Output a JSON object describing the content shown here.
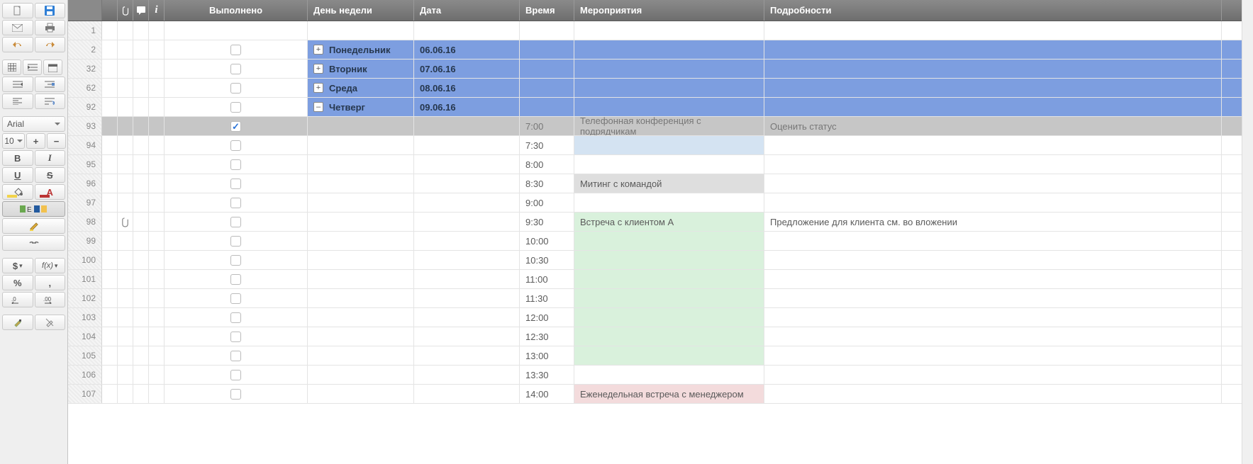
{
  "toolbar": {
    "font_name": "Arial",
    "font_size": "10"
  },
  "headers": {
    "done": "Выполнено",
    "day": "День недели",
    "date": "Дата",
    "time": "Время",
    "event": "Мероприятия",
    "detail": "Подробности"
  },
  "rows": [
    {
      "num": "1",
      "kind": "blank"
    },
    {
      "num": "2",
      "kind": "group",
      "expand": "+",
      "day": "Понедельник",
      "date": "06.06.16"
    },
    {
      "num": "32",
      "kind": "group",
      "expand": "+",
      "day": "Вторник",
      "date": "07.06.16"
    },
    {
      "num": "62",
      "kind": "group",
      "expand": "+",
      "day": "Среда",
      "date": "08.06.16"
    },
    {
      "num": "92",
      "kind": "group",
      "expand": "–",
      "day": "Четверг",
      "date": "09.06.16"
    },
    {
      "num": "93",
      "kind": "sel",
      "checked": true,
      "time": "7:00",
      "event": "Телефонная конференция с подрядчикам",
      "detail": "Оценить статус"
    },
    {
      "num": "94",
      "kind": "data",
      "time": "7:30",
      "event_bg": "blue"
    },
    {
      "num": "95",
      "kind": "data",
      "time": "8:00"
    },
    {
      "num": "96",
      "kind": "data",
      "time": "8:30",
      "event": "Митинг с командой",
      "event_bg": "gray"
    },
    {
      "num": "97",
      "kind": "data",
      "time": "9:00"
    },
    {
      "num": "98",
      "kind": "data",
      "clip": true,
      "time": "9:30",
      "event": "Встреча с клиентом А",
      "event_bg": "green",
      "detail": "Предложение для клиента см. во вложении"
    },
    {
      "num": "99",
      "kind": "data",
      "time": "10:00",
      "event_bg": "green"
    },
    {
      "num": "100",
      "kind": "data",
      "time": "10:30",
      "event_bg": "green"
    },
    {
      "num": "101",
      "kind": "data",
      "time": "11:00",
      "event_bg": "green"
    },
    {
      "num": "102",
      "kind": "data",
      "time": "11:30",
      "event_bg": "green"
    },
    {
      "num": "103",
      "kind": "data",
      "time": "12:00",
      "event_bg": "green"
    },
    {
      "num": "104",
      "kind": "data",
      "time": "12:30",
      "event_bg": "green"
    },
    {
      "num": "105",
      "kind": "data",
      "time": "13:00",
      "event_bg": "green"
    },
    {
      "num": "106",
      "kind": "data",
      "time": "13:30"
    },
    {
      "num": "107",
      "kind": "data",
      "time": "14:00",
      "event": "Еженедельная встреча с менеджером",
      "event_bg": "pink"
    }
  ]
}
